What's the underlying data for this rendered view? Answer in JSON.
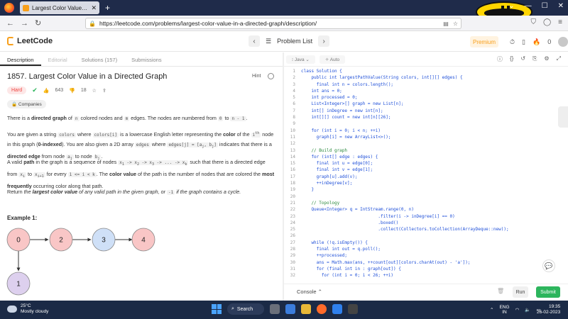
{
  "browser": {
    "tab_title": "Largest Color Value in a Directe",
    "url": "https://leetcode.com/problems/largest-color-value-in-a-directed-graph/description/"
  },
  "header": {
    "logo": "LeetCode",
    "problem_list": "Problem List",
    "premium": "Premium",
    "notif_count": "0"
  },
  "left_tabs": [
    "Description",
    "Editorial",
    "Solutions (157)",
    "Submissions"
  ],
  "problem": {
    "title": "1857. Largest Color Value in a Directed Graph",
    "hint": "Hint",
    "difficulty": "Hard",
    "likes": "643",
    "dislikes": "18",
    "companies": "Companies",
    "p1": "There is a <b>directed graph</b> of <code>n</code> colored nodes and <code>m</code> edges. The nodes are numbered from <code>0</code> to <code>n - 1</code>.",
    "p2": "You are given a string <code>colors</code> where <code>colors[i]</code> is a lowercase English letter representing the <b>color</b> of the <code>i<sup>th</sup></code> node in this graph (<b>0-indexed</b>). You are also given a 2D array <code>edges</code> where <code>edges[j] = [a<sub>j</sub>, b<sub>j</sub>]</code> indicates that there is a <b>directed edge</b> from node <code>a<sub>j</sub></code> to node <code>b<sub>j</sub></code>.",
    "p3": "A valid <b>path</b> in the graph is a sequence of nodes <code>x<sub>1</sub> -&gt; x<sub>2</sub> -&gt; x<sub>3</sub> -&gt; ... -&gt; x<sub>k</sub></code> such that there is a directed edge from <code>x<sub>i</sub></code> to <code>x<sub>i+1</sub></code> for every <code>1 &lt;= i &lt; k</code>. The <b>color value</b> of the path is the number of nodes that are colored the <b>most frequently</b> occurring color along that path.",
    "p4": "Return <i>the <b>largest color value</b> of any valid path in the given graph, or</i> <code>-1</code> <i>if the graph contains a cycle.</i>",
    "example_title": "Example 1:"
  },
  "graph_nodes": [
    {
      "label": "0",
      "color": "#f9c6c6"
    },
    {
      "label": "2",
      "color": "#f9c6c6"
    },
    {
      "label": "3",
      "color": "#cfe0f7"
    },
    {
      "label": "4",
      "color": "#f9c6c6"
    },
    {
      "label": "1",
      "color": "#ddd0ee"
    }
  ],
  "editor": {
    "language": "Java",
    "auto": "Auto",
    "lines": [
      {
        "n": "1",
        "t": "class Solution {"
      },
      {
        "n": "2",
        "t": "    public int largestPathValue(String colors, int[][] edges) {"
      },
      {
        "n": "3",
        "t": "      final int n = colors.length();"
      },
      {
        "n": "4",
        "t": "    int ans = 0;"
      },
      {
        "n": "5",
        "t": "    int processed = 0;"
      },
      {
        "n": "6",
        "t": "    List<Integer>[] graph = new List[n];"
      },
      {
        "n": "7",
        "t": "    int[] inDegree = new int[n];"
      },
      {
        "n": "8",
        "t": "    int[][] count = new int[n][26];"
      },
      {
        "n": "9",
        "t": ""
      },
      {
        "n": "10",
        "t": "    for (int i = 0; i < n; ++i)"
      },
      {
        "n": "11",
        "t": "      graph[i] = new ArrayList<>();"
      },
      {
        "n": "12",
        "t": ""
      },
      {
        "n": "13",
        "t": "    // Build graph",
        "c": true
      },
      {
        "n": "14",
        "t": "    for (int[] edge : edges) {"
      },
      {
        "n": "15",
        "t": "      final int u = edge[0];"
      },
      {
        "n": "16",
        "t": "      final int v = edge[1];"
      },
      {
        "n": "17",
        "t": "      graph[u].add(v);"
      },
      {
        "n": "18",
        "t": "      ++inDegree[v];"
      },
      {
        "n": "19",
        "t": "    }"
      },
      {
        "n": "20",
        "t": ""
      },
      {
        "n": "21",
        "t": "    // Topology",
        "c": true
      },
      {
        "n": "22",
        "t": "    Queue<Integer> q = IntStream.range(0, n)"
      },
      {
        "n": "23",
        "t": "                              .filter(i -> inDegree[i] == 0)"
      },
      {
        "n": "24",
        "t": "                              .boxed()"
      },
      {
        "n": "25",
        "t": "                              .collect(Collectors.toCollection(ArrayDeque::new));"
      },
      {
        "n": "26",
        "t": ""
      },
      {
        "n": "27",
        "t": "    while (!q.isEmpty()) {"
      },
      {
        "n": "28",
        "t": "      final int out = q.poll();"
      },
      {
        "n": "29",
        "t": "      ++processed;"
      },
      {
        "n": "30",
        "t": "      ans = Math.max(ans, ++count[out][colors.charAt(out) - 'a']);"
      },
      {
        "n": "31",
        "t": "      for (final int in : graph[out]) {"
      },
      {
        "n": "32",
        "t": "        for (int i = 0; i < 26; ++i)"
      }
    ]
  },
  "console": {
    "label": "Console",
    "run": "Run",
    "submit": "Submit"
  },
  "taskbar": {
    "temp": "25°C",
    "weather": "Mostly cloudy",
    "search": "Search",
    "lang1": "ENG",
    "lang2": "IN",
    "time": "19:35",
    "date": "26-02-2023"
  }
}
